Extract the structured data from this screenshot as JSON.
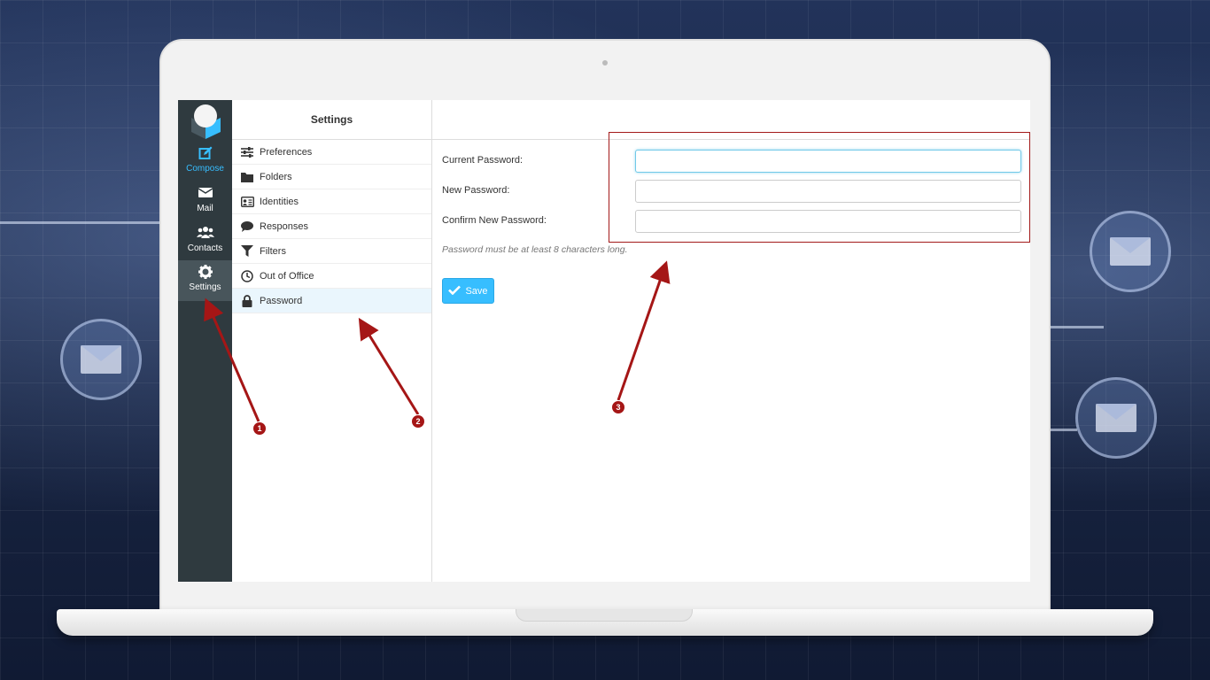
{
  "taskbar": {
    "items": [
      {
        "label": "Compose",
        "icon": "compose-icon"
      },
      {
        "label": "Mail",
        "icon": "envelope-icon"
      },
      {
        "label": "Contacts",
        "icon": "contacts-icon"
      },
      {
        "label": "Settings",
        "icon": "gear-icon"
      }
    ],
    "active": "Settings",
    "accent_color": "#37beff"
  },
  "settings": {
    "title": "Settings",
    "items": [
      {
        "label": "Preferences",
        "icon": "sliders-icon"
      },
      {
        "label": "Folders",
        "icon": "folder-icon"
      },
      {
        "label": "Identities",
        "icon": "id-card-icon"
      },
      {
        "label": "Responses",
        "icon": "speech-bubble-icon"
      },
      {
        "label": "Filters",
        "icon": "filter-icon"
      },
      {
        "label": "Out of Office",
        "icon": "clock-icon"
      },
      {
        "label": "Password",
        "icon": "lock-icon"
      }
    ],
    "selected": "Password"
  },
  "password_form": {
    "current_label": "Current Password:",
    "new_label": "New Password:",
    "confirm_label": "Confirm New Password:",
    "current_value": "",
    "new_value": "",
    "confirm_value": "",
    "hint": "Password must be at least 8 characters long.",
    "save_label": "Save"
  },
  "annotations": {
    "badges": [
      "1",
      "2",
      "3"
    ],
    "color": "#a51616"
  }
}
